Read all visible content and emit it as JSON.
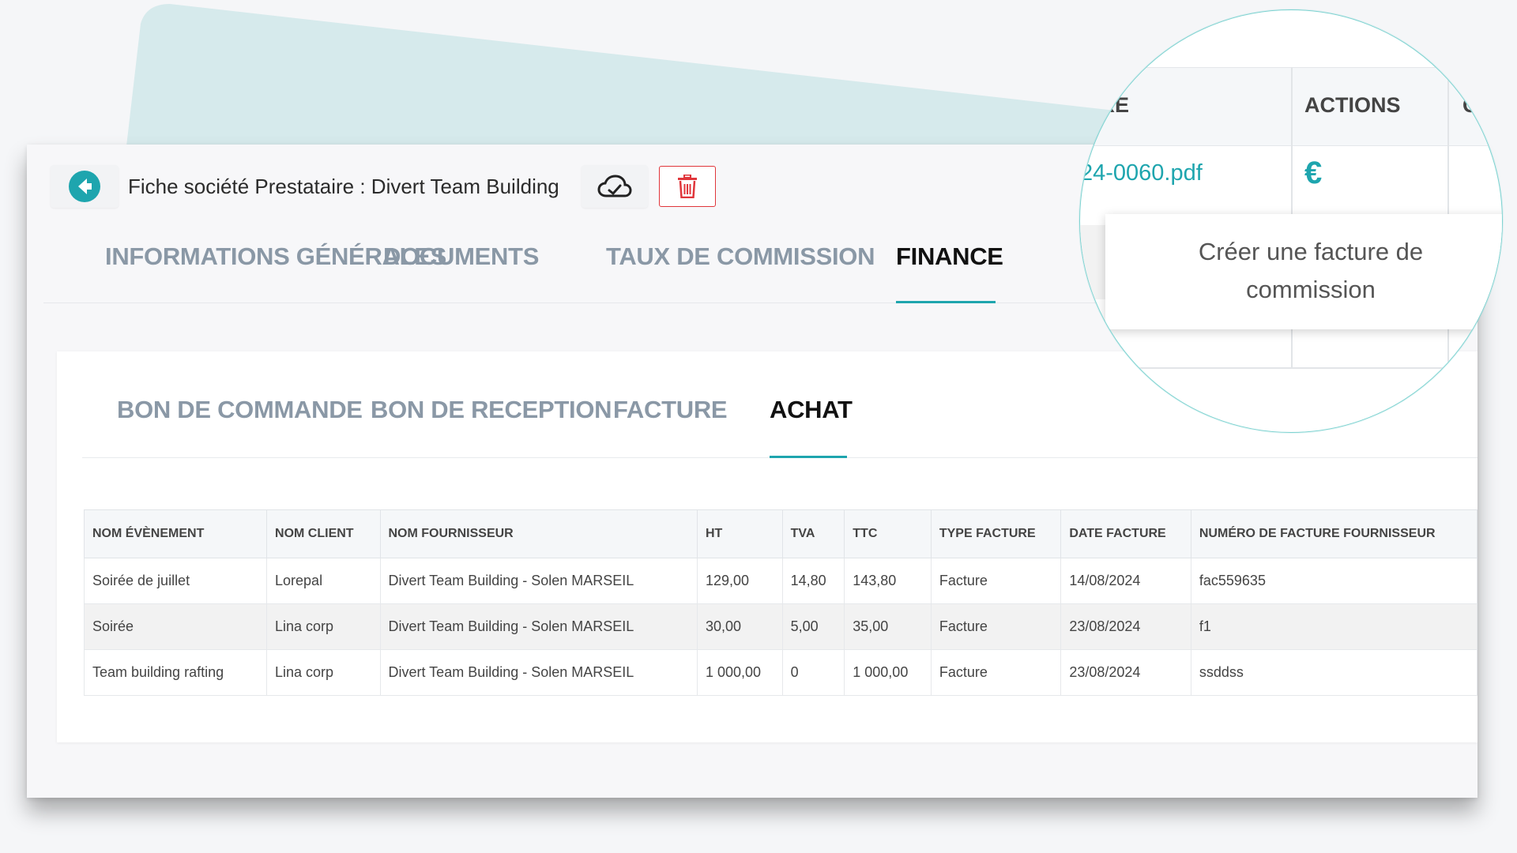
{
  "header": {
    "title": "Fiche société Prestataire : Divert Team Building",
    "icons": {
      "back": "arrow-left-circle-icon",
      "cloud": "cloud-sync-icon",
      "delete": "trash-icon"
    }
  },
  "main_tabs": [
    {
      "label": "INFORMATIONS GÉNÉRALES",
      "active": false
    },
    {
      "label": "DOCUMENTS",
      "active": false
    },
    {
      "label": "TAUX DE COMMISSION",
      "active": false
    },
    {
      "label": "FINANCE",
      "active": true
    }
  ],
  "sub_tabs": [
    {
      "label": "BON DE COMMANDE",
      "active": false
    },
    {
      "label": "BON DE RECEPTION",
      "active": false
    },
    {
      "label": "FACTURE",
      "active": false
    },
    {
      "label": "ACHAT",
      "active": true
    }
  ],
  "table": {
    "headers": [
      "NOM ÉVÈNEMENT",
      "NOM CLIENT",
      "NOM FOURNISSEUR",
      "HT",
      "TVA",
      "TTC",
      "TYPE FACTURE",
      "DATE FACTURE",
      "NUMÉRO DE FACTURE FOURNISSEUR"
    ],
    "rows": [
      [
        "Soirée de juillet",
        "Lorepal",
        "Divert Team Building - Solen MARSEIL",
        "129,00",
        "14,80",
        "143,80",
        "Facture",
        "14/08/2024",
        "fac559635"
      ],
      [
        "Soirée",
        "Lina corp",
        "Divert Team Building - Solen MARSEIL",
        "30,00",
        "5,00",
        "35,00",
        "Facture",
        "23/08/2024",
        "f1"
      ],
      [
        "Team building rafting",
        "Lina corp",
        "Divert Team Building - Solen MARSEIL",
        "1 000,00",
        "0",
        "1 000,00",
        "Facture",
        "23/08/2024",
        "ssddss"
      ]
    ]
  },
  "magnifier": {
    "header_partial": "URE",
    "header_actions": "ACTIONS",
    "header_next_partial": "C",
    "file_link_partial": "24-0060.pdf",
    "euro_symbol": "€",
    "tooltip_line1": "Créer une facture de",
    "tooltip_line2": "commission"
  },
  "colors": {
    "accent": "#1ea5ae",
    "danger": "#e0363b",
    "tab_inactive": "#8a98a6"
  }
}
